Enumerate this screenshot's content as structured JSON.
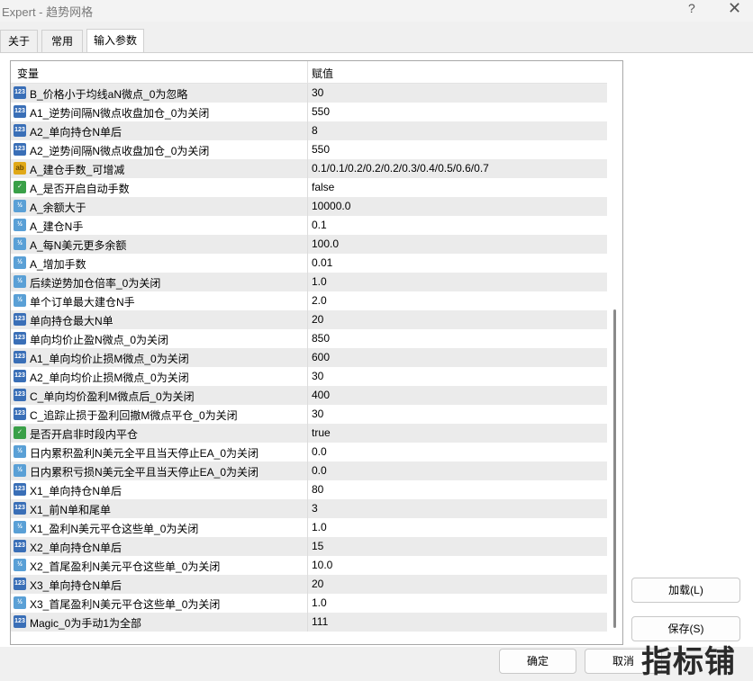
{
  "window": {
    "title": "Expert - 趋势网格",
    "help": "?",
    "close": "✕"
  },
  "tabs": [
    {
      "label": "关于"
    },
    {
      "label": "常用"
    },
    {
      "label": "输入参数"
    }
  ],
  "grid": {
    "col_variable": "变量",
    "col_value": "赋值",
    "rows": [
      {
        "type": "int",
        "icon": "123",
        "name": "B_价格小于均线aN微点_0为忽略",
        "value": "30"
      },
      {
        "type": "int",
        "icon": "123",
        "name": "A1_逆势间隔N微点收盘加仓_0为关闭",
        "value": "550"
      },
      {
        "type": "int",
        "icon": "123",
        "name": "A2_单向持仓N单后",
        "value": "8"
      },
      {
        "type": "int",
        "icon": "123",
        "name": "A2_逆势间隔N微点收盘加仓_0为关闭",
        "value": "550"
      },
      {
        "type": "str",
        "icon": "ab",
        "name": "A_建仓手数_可增减",
        "value": "0.1/0.1/0.2/0.2/0.2/0.3/0.4/0.5/0.6/0.7"
      },
      {
        "type": "bool",
        "icon": "✓",
        "name": "A_是否开启自动手数",
        "value": "false"
      },
      {
        "type": "dbl",
        "icon": "½",
        "name": "A_余额大于",
        "value": "10000.0"
      },
      {
        "type": "dbl",
        "icon": "½",
        "name": "A_建仓N手",
        "value": "0.1"
      },
      {
        "type": "dbl",
        "icon": "½",
        "name": "A_每N美元更多余额",
        "value": "100.0"
      },
      {
        "type": "dbl",
        "icon": "½",
        "name": "A_增加手数",
        "value": "0.01"
      },
      {
        "type": "dbl",
        "icon": "½",
        "name": "后续逆势加仓倍率_0为关闭",
        "value": "1.0"
      },
      {
        "type": "dbl",
        "icon": "½",
        "name": "单个订单最大建仓N手",
        "value": "2.0"
      },
      {
        "type": "int",
        "icon": "123",
        "name": "单向持仓最大N单",
        "value": "20"
      },
      {
        "type": "int",
        "icon": "123",
        "name": "单向均价止盈N微点_0为关闭",
        "value": "850"
      },
      {
        "type": "int",
        "icon": "123",
        "name": "A1_单向均价止损M微点_0为关闭",
        "value": "600"
      },
      {
        "type": "int",
        "icon": "123",
        "name": "A2_单向均价止损M微点_0为关闭",
        "value": "30"
      },
      {
        "type": "int",
        "icon": "123",
        "name": "C_单向均价盈利M微点后_0为关闭",
        "value": "400"
      },
      {
        "type": "int",
        "icon": "123",
        "name": "C_追踪止损于盈利回撤M微点平仓_0为关闭",
        "value": "30"
      },
      {
        "type": "bool",
        "icon": "✓",
        "name": "是否开启非时段内平仓",
        "value": "true"
      },
      {
        "type": "dbl",
        "icon": "½",
        "name": "日内累积盈利N美元全平且当天停止EA_0为关闭",
        "value": "0.0"
      },
      {
        "type": "dbl",
        "icon": "½",
        "name": "日内累积亏损N美元全平且当天停止EA_0为关闭",
        "value": "0.0"
      },
      {
        "type": "int",
        "icon": "123",
        "name": "X1_单向持仓N单后",
        "value": "80"
      },
      {
        "type": "int",
        "icon": "123",
        "name": "X1_前N单和尾单",
        "value": "3"
      },
      {
        "type": "dbl",
        "icon": "½",
        "name": "X1_盈利N美元平仓这些单_0为关闭",
        "value": "1.0"
      },
      {
        "type": "int",
        "icon": "123",
        "name": "X2_单向持仓N单后",
        "value": "15"
      },
      {
        "type": "dbl",
        "icon": "½",
        "name": "X2_首尾盈利N美元平仓这些单_0为关闭",
        "value": "10.0"
      },
      {
        "type": "int",
        "icon": "123",
        "name": "X3_单向持仓N单后",
        "value": "20"
      },
      {
        "type": "dbl",
        "icon": "½",
        "name": "X3_首尾盈利N美元平仓这些单_0为关闭",
        "value": "1.0"
      },
      {
        "type": "int",
        "icon": "123",
        "name": "Magic_0为手动1为全部",
        "value": "111"
      }
    ]
  },
  "buttons": {
    "load": "加载(L)",
    "save": "保存(S)",
    "ok": "确定",
    "cancel": "取消"
  },
  "watermark": "指标铺"
}
